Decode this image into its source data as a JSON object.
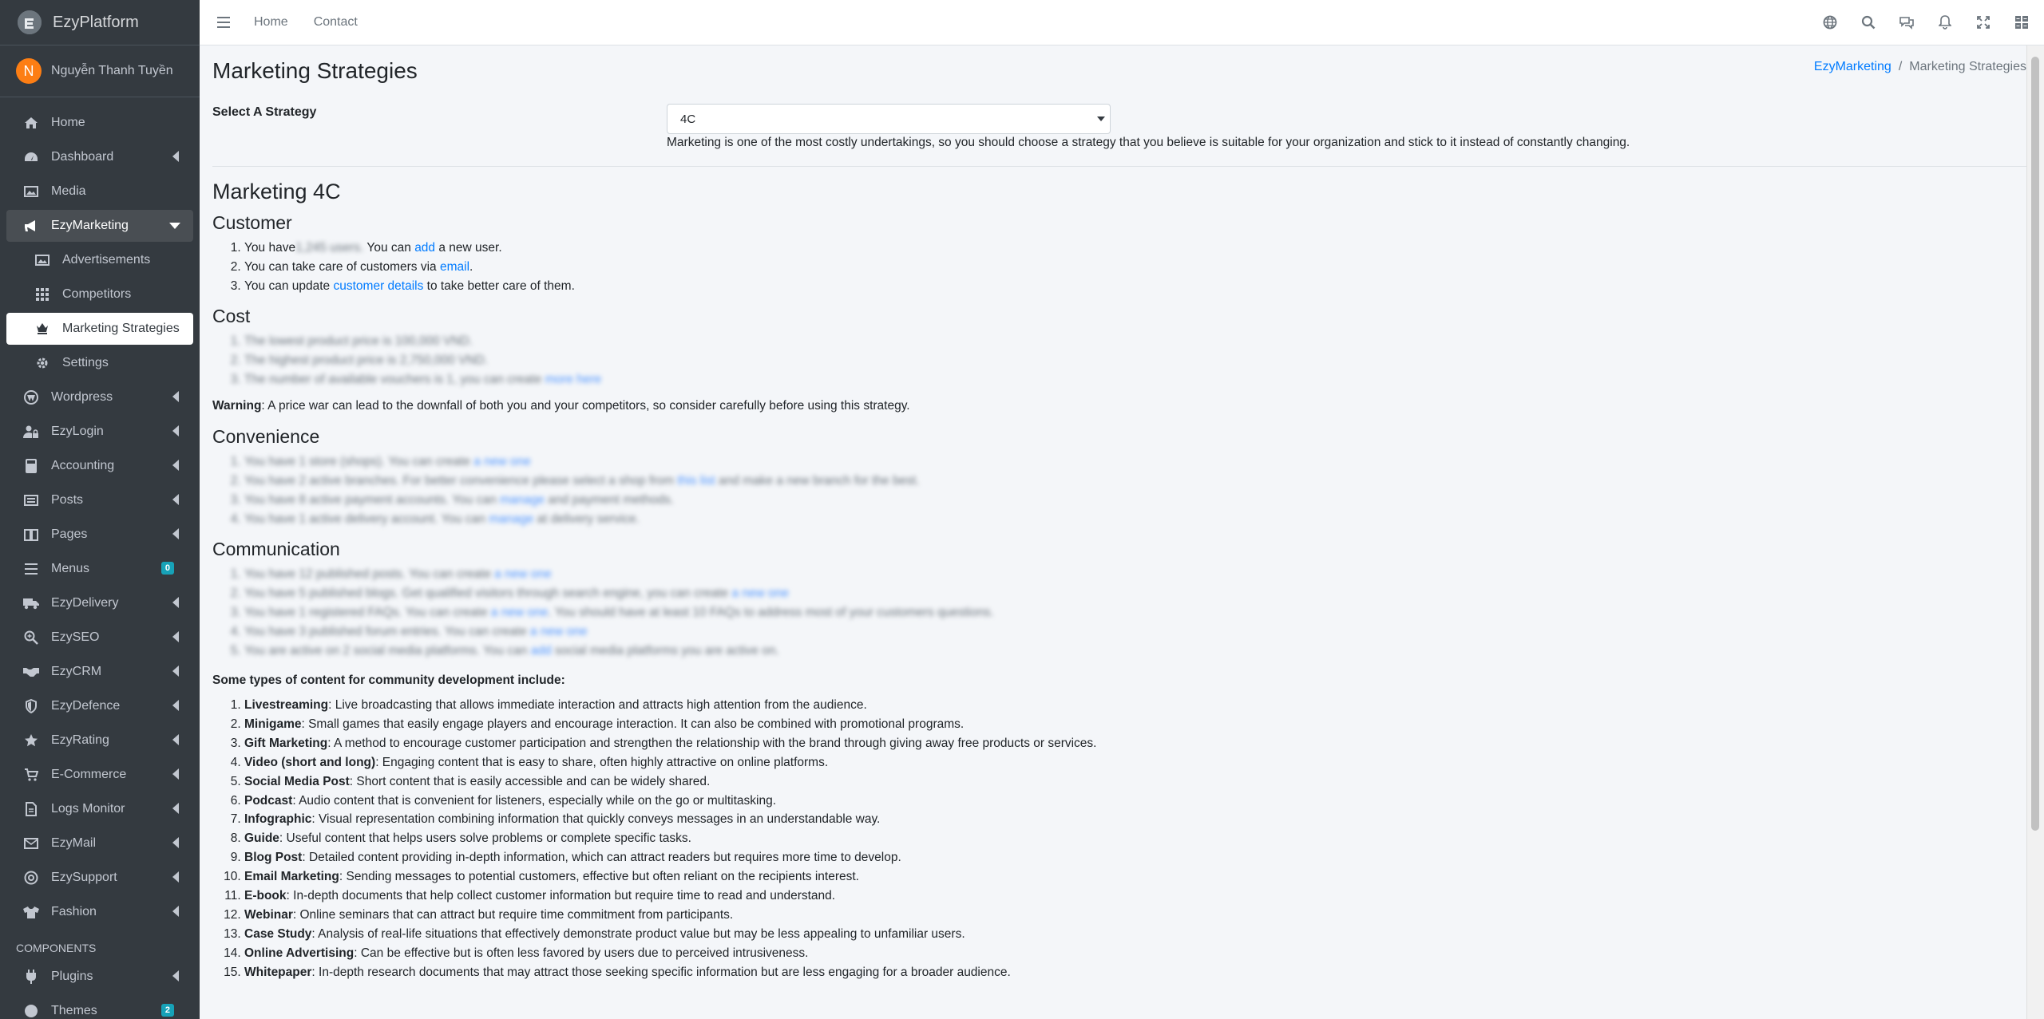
{
  "brand": {
    "name": "EzyPlatform"
  },
  "user": {
    "initial": "N",
    "name": "Nguyễn Thanh Tuyền"
  },
  "sidebar": {
    "items": [
      {
        "label": "Home"
      },
      {
        "label": "Dashboard"
      },
      {
        "label": "Media"
      },
      {
        "label": "EzyMarketing"
      },
      {
        "label": "Advertisements"
      },
      {
        "label": "Competitors"
      },
      {
        "label": "Marketing Strategies"
      },
      {
        "label": "Settings"
      },
      {
        "label": "Wordpress"
      },
      {
        "label": "EzyLogin"
      },
      {
        "label": "Accounting"
      },
      {
        "label": "Posts"
      },
      {
        "label": "Pages"
      },
      {
        "label": "Menus",
        "badge": "0"
      },
      {
        "label": "EzyDelivery"
      },
      {
        "label": "EzySEO"
      },
      {
        "label": "EzyCRM"
      },
      {
        "label": "EzyDefence"
      },
      {
        "label": "EzyRating"
      },
      {
        "label": "E-Commerce"
      },
      {
        "label": "Logs Monitor"
      },
      {
        "label": "EzyMail"
      },
      {
        "label": "EzySupport"
      },
      {
        "label": "Fashion"
      }
    ],
    "components_header": "COMPONENTS",
    "component_items": [
      {
        "label": "Plugins"
      },
      {
        "label": "Themes",
        "badge": "2"
      }
    ]
  },
  "topbar": {
    "home": "Home",
    "contact": "Contact"
  },
  "page": {
    "title": "Marketing Strategies",
    "breadcrumb": {
      "parent": "EzyMarketing",
      "sep": "/",
      "current": "Marketing Strategies"
    },
    "strategy_label": "Select A Strategy",
    "strategy_value": "4C",
    "strategy_help": "Marketing is one of the most costly undertakings, so you should choose a strategy that you believe is suitable for your organization and stick to it instead of constantly changing."
  },
  "marketing4c": {
    "title": "Marketing 4C",
    "customer": {
      "title": "Customer",
      "line1_a": "You have",
      "line1_blur": "1,245 users.",
      "line1_b": " You can ",
      "line1_link": "add",
      "line1_c": " a new user.",
      "line2_a": "You can take care of customers via ",
      "line2_link": "email",
      "line2_b": ".",
      "line3_a": "You can update ",
      "line3_link": "customer details",
      "line3_b": " to take better care of them."
    },
    "cost": {
      "title": "Cost",
      "blurred": [
        "The lowest product price is 100,000 VND.",
        "The highest product price is 2,750,000 VND.",
        "The number of available vouchers is 1, you can create ",
        "more here"
      ]
    },
    "warning_label": "Warning",
    "warning_text": ": A price war can lead to the downfall of both you and your competitors, so consider carefully before using this strategy.",
    "convenience": {
      "title": "Convenience",
      "blurred": [
        "You have 1 store (shops). You can create ",
        "a new one",
        "You have 2 active branches. For better convenience please select a shop from ",
        "this list",
        " and make a new branch for the best.",
        "You have 8 active payment accounts. You can ",
        "manage",
        " and payment methods.",
        "You have 1 active delivery account. You can ",
        "manage",
        " at delivery service."
      ]
    },
    "communication": {
      "title": "Communication",
      "blurred": [
        "You have 12 published posts. You can create ",
        "a new one",
        "You have 5 published blogs. Get qualified visitors through search engine, you can create ",
        "a new one",
        "You have 1 registered FAQs. You can create ",
        "a new one",
        ". You should have at least 10 FAQs to address most of your customers questions.",
        "You have 3 published forum entries. You can create ",
        "a new one",
        "You are active on 2 social media platforms. You can ",
        "add",
        " social media platforms you are active on."
      ]
    },
    "content_types_title": "Some types of content for community development include:",
    "content_types": [
      {
        "name": "Livestreaming",
        "desc": ": Live broadcasting that allows immediate interaction and attracts high attention from the audience."
      },
      {
        "name": "Minigame",
        "desc": ": Small games that easily engage players and encourage interaction. It can also be combined with promotional programs."
      },
      {
        "name": "Gift Marketing",
        "desc": ": A method to encourage customer participation and strengthen the relationship with the brand through giving away free products or services."
      },
      {
        "name": "Video (short and long)",
        "desc": ": Engaging content that is easy to share, often highly attractive on online platforms."
      },
      {
        "name": "Social Media Post",
        "desc": ": Short content that is easily accessible and can be widely shared."
      },
      {
        "name": "Podcast",
        "desc": ": Audio content that is convenient for listeners, especially while on the go or multitasking."
      },
      {
        "name": "Infographic",
        "desc": ": Visual representation combining information that quickly conveys messages in an understandable way."
      },
      {
        "name": "Guide",
        "desc": ": Useful content that helps users solve problems or complete specific tasks."
      },
      {
        "name": "Blog Post",
        "desc": ": Detailed content providing in-depth information, which can attract readers but requires more time to develop."
      },
      {
        "name": "Email Marketing",
        "desc": ": Sending messages to potential customers, effective but often reliant on the recipients interest."
      },
      {
        "name": "E-book",
        "desc": ": In-depth documents that help collect customer information but require time to read and understand."
      },
      {
        "name": "Webinar",
        "desc": ": Online seminars that can attract but require time commitment from participants."
      },
      {
        "name": "Case Study",
        "desc": ": Analysis of real-life situations that effectively demonstrate product value but may be less appealing to unfamiliar users."
      },
      {
        "name": "Online Advertising",
        "desc": ": Can be effective but is often less favored by users due to perceived intrusiveness."
      },
      {
        "name": "Whitepaper",
        "desc": ": In-depth research documents that may attract those seeking specific information but are less engaging for a broader audience."
      }
    ]
  }
}
